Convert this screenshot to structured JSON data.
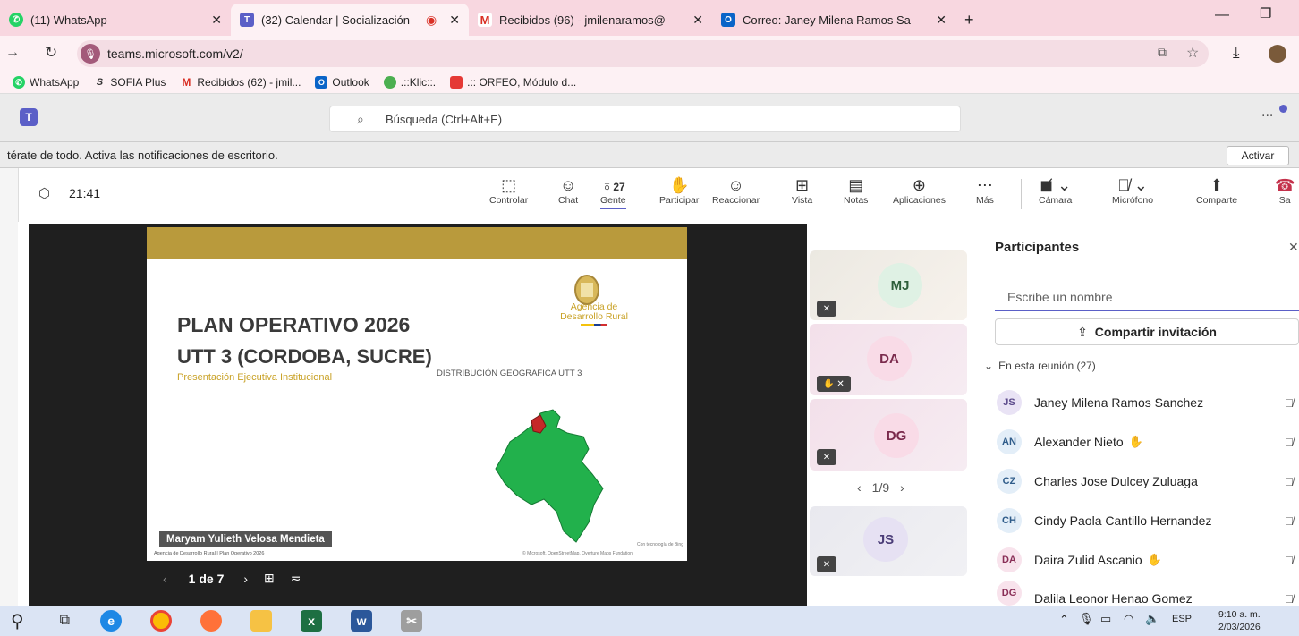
{
  "browser": {
    "tabs": [
      {
        "label": "(11) WhatsApp",
        "icon": "whatsapp-icon"
      },
      {
        "label": "(32) Calendar | Socialización",
        "icon": "teams-icon",
        "active": true
      },
      {
        "label": "Recibidos (96) - jmilenaramos@",
        "icon": "gmail-icon"
      },
      {
        "label": "Correo: Janey Milena Ramos Sa",
        "icon": "outlook-icon"
      }
    ],
    "new_tab": "+",
    "url": "teams.microsoft.com/v2/",
    "bookmarks": [
      {
        "label": "WhatsApp",
        "icon": "whatsapp-icon"
      },
      {
        "label": "SOFIA Plus",
        "icon": "sofia-icon"
      },
      {
        "label": "Recibidos (62) - jmil...",
        "icon": "gmail-icon"
      },
      {
        "label": "Outlook",
        "icon": "outlook-icon"
      },
      {
        "label": ".::Klic::.",
        "icon": "klic-icon"
      },
      {
        "label": ".:: ORFEO, Módulo d...",
        "icon": "orfeo-icon"
      }
    ]
  },
  "teams": {
    "search_placeholder": "Búsqueda (Ctrl+Alt+E)",
    "notification": "térate de todo. Activa las notificaciones de escritorio.",
    "activate_label": "Activar",
    "more": "..."
  },
  "meeting": {
    "timer": "21:41",
    "toolbar": [
      {
        "label": "Controlar",
        "icon": "control-icon"
      },
      {
        "label": "Chat",
        "icon": "chat-icon"
      },
      {
        "label": "Gente",
        "icon": "people-icon",
        "count": "27"
      },
      {
        "label": "Participar",
        "icon": "raise-hand-icon"
      },
      {
        "label": "Reaccionar",
        "icon": "react-icon"
      },
      {
        "label": "Vista",
        "icon": "view-icon"
      },
      {
        "label": "Notas",
        "icon": "notes-icon"
      },
      {
        "label": "Aplicaciones",
        "icon": "apps-icon"
      },
      {
        "label": "Más",
        "icon": "more-icon"
      },
      {
        "label": "Cámara",
        "icon": "camera-off-icon"
      },
      {
        "label": "Micrófono",
        "icon": "mic-off-icon"
      },
      {
        "label": "Comparte",
        "icon": "share-icon"
      },
      {
        "label": "Sa",
        "icon": "leave-icon"
      }
    ],
    "slide": {
      "title": "PLAN OPERATIVO 2026",
      "subtitle": "UTT 3 (CORDOBA, SUCRE)",
      "tagline": "Presentación Ejecutiva Institucional",
      "map_title": "DISTRIBUCIÓN GEOGRÁFICA UTT 3",
      "agency_line1": "Agencia de",
      "agency_line2": "Desarrollo Rural",
      "presenter": "Maryam Yulieth Velosa Mendieta",
      "footer": "Agencia de Desarrollo Rural | Plan Operativo 2026",
      "credits": "© Microsoft, OpenStreetMap, Overture Maps Fundation",
      "bing": "Con tecnología de Bing"
    },
    "slide_nav": {
      "page": "1 de 7",
      "prev": "‹",
      "next": "›"
    },
    "videos": [
      {
        "initials": "MJ"
      },
      {
        "initials": "DA"
      },
      {
        "initials": "DG"
      },
      {
        "initials": "JS"
      }
    ],
    "video_pager": "1/9"
  },
  "participants": {
    "title": "Participantes",
    "search_placeholder": "Escribe un nombre",
    "invite_label": "Compartir invitación",
    "section_label": "En esta reunión (27)",
    "list": [
      {
        "initials": "JS",
        "name": "Janey Milena Ramos Sanchez",
        "color": "#e9e3f5",
        "fg": "#5b4a8b"
      },
      {
        "initials": "AN",
        "name": "Alexander Nieto",
        "color": "#e3eef8",
        "fg": "#2f5c8a",
        "hand": true
      },
      {
        "initials": "CZ",
        "name": "Charles Jose Dulcey Zuluaga",
        "color": "#e3eef8",
        "fg": "#2f5c8a"
      },
      {
        "initials": "CH",
        "name": "Cindy Paola Cantillo Hernandez",
        "color": "#e3eef8",
        "fg": "#2f5c8a"
      },
      {
        "initials": "DA",
        "name": "Daira Zulid Ascanio",
        "color": "#f8e3ec",
        "fg": "#8a2f57",
        "hand": true
      },
      {
        "initials": "DG",
        "name": "Dalila Leonor Henao Gomez",
        "color": "#f8e3ec",
        "fg": "#8a2f57"
      }
    ]
  },
  "taskbar": {
    "lang": "ESP",
    "time": "9:10 a. m.",
    "date": "2/03/2026"
  },
  "colors": {
    "tab_bar": "#f8d7e0",
    "accent": "#5b5fc7",
    "slide_gold": "#b99a3c",
    "slide_title": "#3a3a3a",
    "map_green": "#22b14c"
  }
}
